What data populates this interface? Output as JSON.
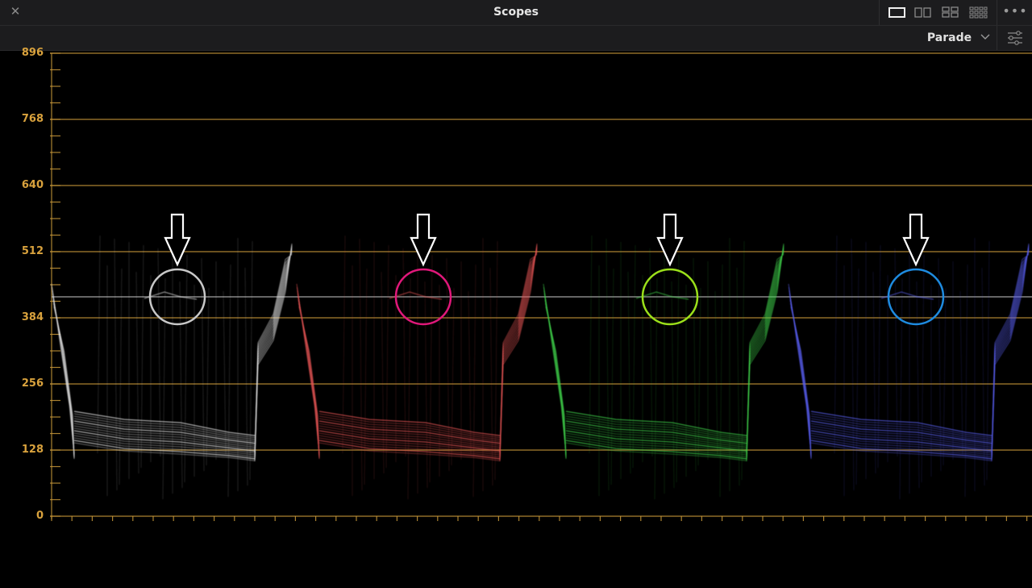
{
  "window": {
    "title": "Scopes"
  },
  "toolbar": {
    "scope_mode": "Parade"
  },
  "icons": {
    "close": "close-icon",
    "single_view": "single-view-icon",
    "dual_view": "dual-view-icon",
    "quad_view": "quad-view-icon",
    "grid_view": "grid-view-icon",
    "more": "more-options-icon",
    "settings": "sliders-icon"
  },
  "scope": {
    "y_axis_labels": [
      "896",
      "768",
      "640",
      "512",
      "384",
      "256",
      "128",
      "0"
    ],
    "graticule_color": "#c9993a",
    "channels": [
      {
        "name": "luma",
        "circle_color": "#c8c8c8",
        "trace_color": "#e6e6e6"
      },
      {
        "name": "red",
        "circle_color": "#e0187a",
        "trace_color": "#e85555"
      },
      {
        "name": "green",
        "circle_color": "#9be01a",
        "trace_color": "#3fd24a"
      },
      {
        "name": "blue",
        "circle_color": "#1e8be0",
        "trace_color": "#5a5ff0"
      }
    ]
  }
}
